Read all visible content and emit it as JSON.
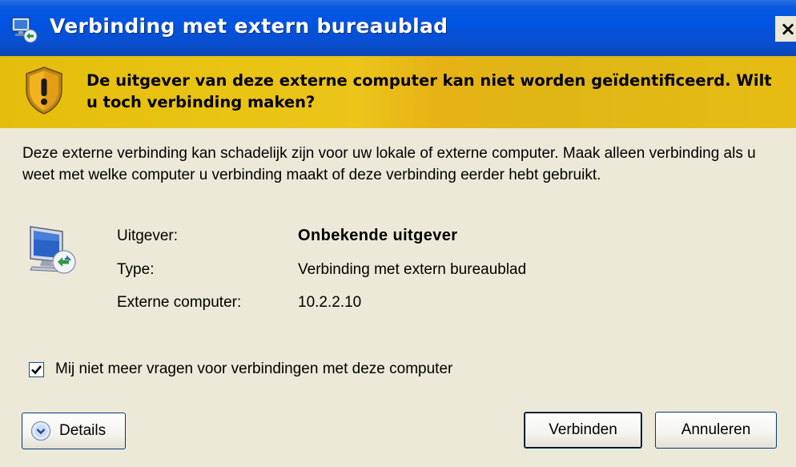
{
  "window": {
    "title": "Verbinding met extern bureaublad",
    "close_label": "×"
  },
  "banner": {
    "heading": "De uitgever van deze externe computer kan niet worden geïdentificeerd. Wilt u toch verbinding maken?"
  },
  "body": {
    "description": "Deze externe verbinding kan schadelijk zijn voor uw lokale of externe computer. Maak alleen verbinding als u weet met welke computer u verbinding maakt of deze verbinding eerder hebt gebruikt.",
    "info": {
      "publisher_label": "Uitgever:",
      "publisher_value": "Onbekende uitgever",
      "type_label": "Type:",
      "type_value": "Verbinding met extern bureaublad",
      "computer_label": "Externe computer:",
      "computer_value": "10.2.2.10"
    },
    "checkbox": {
      "label": "Mij niet meer vragen voor verbindingen met deze computer",
      "checked": true
    }
  },
  "buttons": {
    "details": "Details",
    "connect": "Verbinden",
    "cancel": "Annuleren"
  },
  "icons": {
    "app": "remote-desktop-icon",
    "warning": "warning-shield-icon",
    "monitor": "remote-computer-icon",
    "details_chevron": "chevron-down-icon",
    "close": "close-icon"
  },
  "colors": {
    "titlebar": "#0054e3",
    "banner": "#e9c413",
    "background": "#ece9d8",
    "button_border": "#003c74"
  }
}
